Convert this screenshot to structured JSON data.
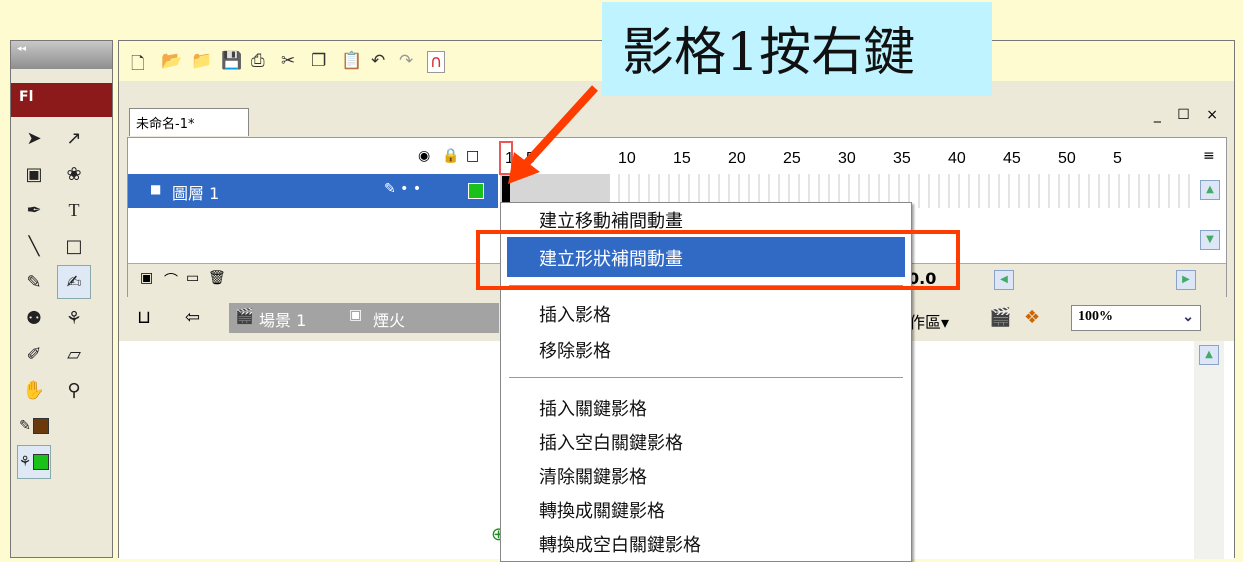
{
  "callout": {
    "text": "影格1按右鍵"
  },
  "tools": {
    "collapse_label": "◂◂",
    "logo": "Fl",
    "icons": [
      "arrow-icon",
      "subselect-icon",
      "free-transform-icon",
      "lasso-icon",
      "pen-icon",
      "text-icon",
      "line-icon",
      "rectangle-icon",
      "pencil-icon",
      "brush-icon",
      "ink-bottle-icon",
      "paint-bucket-icon",
      "eyedropper-icon",
      "eraser-icon",
      "hand-icon",
      "zoom-icon",
      "stroke-color-icon",
      "fill-color-icon"
    ]
  },
  "document": {
    "tab_label": "未命名-1*",
    "window_controls": "_ ☐ ×"
  },
  "timeline": {
    "frame_numbers": [
      "1",
      "5",
      "10",
      "15",
      "20",
      "25",
      "30",
      "35",
      "40",
      "45",
      "50",
      "5"
    ],
    "layer_name": "圖層 1",
    "fps_fragment": "0.0"
  },
  "scene": {
    "scene_label": "場景 1",
    "symbol_label": "煙火",
    "workarea_fragment": "作區▾",
    "zoom": "100%"
  },
  "context_menu": {
    "items": [
      "建立移動補間動畫",
      "建立形狀補間動畫",
      "插入影格",
      "移除影格",
      "插入關鍵影格",
      "插入空白關鍵影格",
      "清除關鍵影格",
      "轉換成關鍵影格",
      "轉換成空白關鍵影格"
    ],
    "highlighted_index": 1
  },
  "colors": {
    "background": "#fffbd0",
    "callout": "#bff3ff",
    "highlight": "#316ac5",
    "annotation": "#ff3c00"
  }
}
